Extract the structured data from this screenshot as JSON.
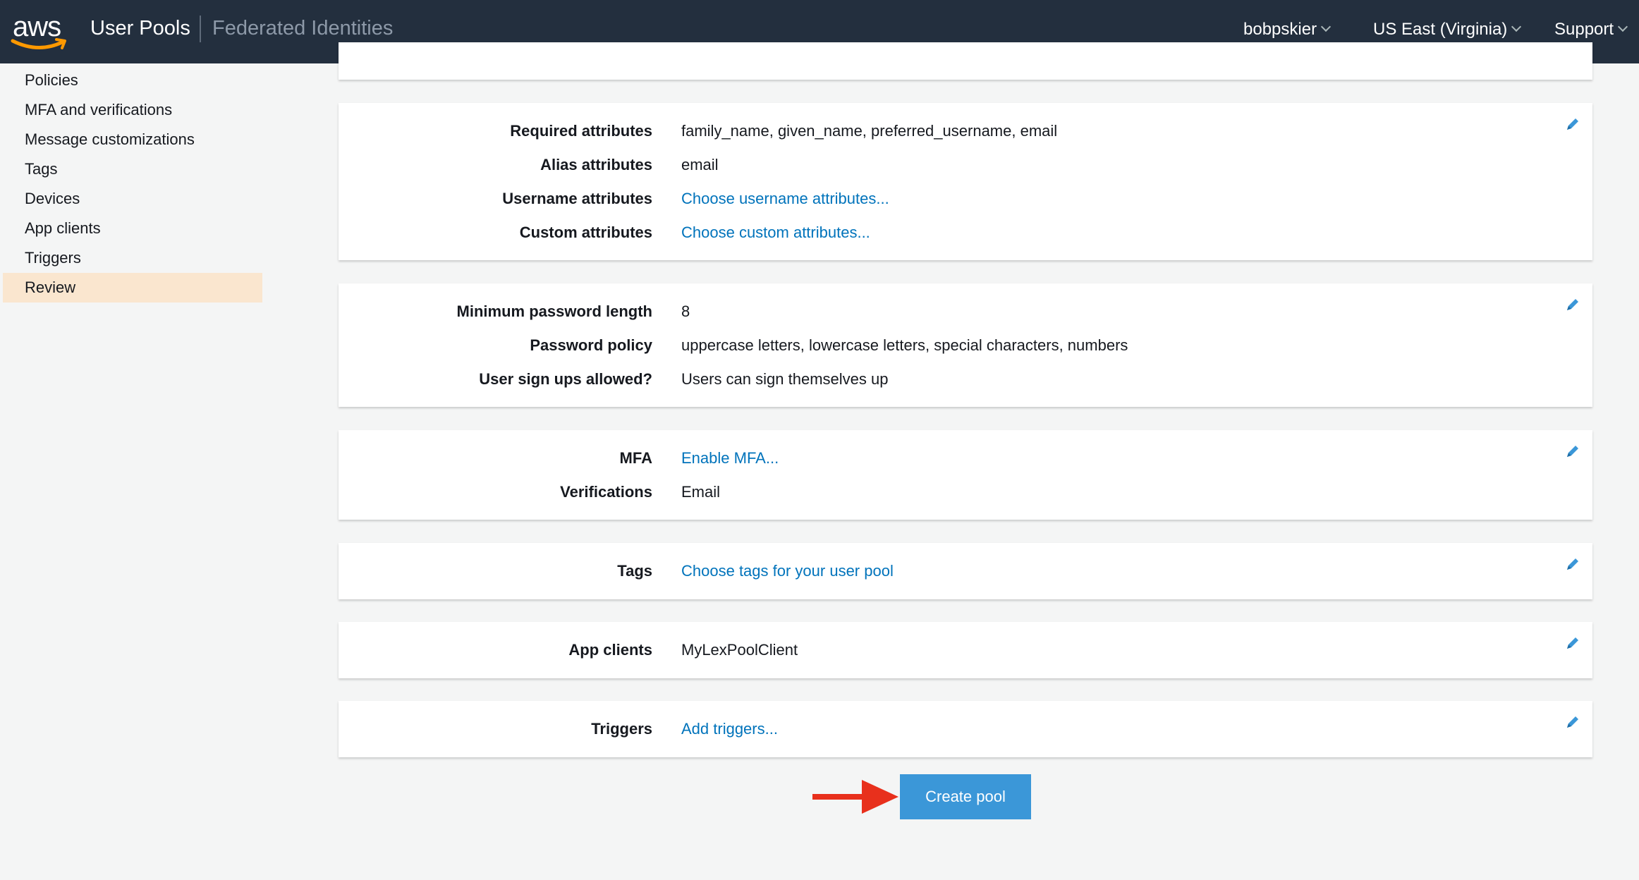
{
  "header": {
    "logo_text": "aws",
    "nav_main": "User Pools",
    "nav_sub": "Federated Identities",
    "user": "bobpskier",
    "region": "US East (Virginia)",
    "support": "Support"
  },
  "sidebar": {
    "items": [
      {
        "label": "Policies"
      },
      {
        "label": "MFA and verifications"
      },
      {
        "label": "Message customizations"
      },
      {
        "label": "Tags"
      },
      {
        "label": "Devices"
      },
      {
        "label": "App clients"
      },
      {
        "label": "Triggers"
      },
      {
        "label": "Review"
      }
    ],
    "active": "Review"
  },
  "sections": {
    "attributes": {
      "required_label": "Required attributes",
      "required_value": "family_name, given_name, preferred_username, email",
      "alias_label": "Alias attributes",
      "alias_value": "email",
      "username_label": "Username attributes",
      "username_value": "Choose username attributes...",
      "custom_label": "Custom attributes",
      "custom_value": "Choose custom attributes..."
    },
    "policies": {
      "minlen_label": "Minimum password length",
      "minlen_value": "8",
      "policy_label": "Password policy",
      "policy_value": "uppercase letters, lowercase letters, special characters, numbers",
      "signup_label": "User sign ups allowed?",
      "signup_value": "Users can sign themselves up"
    },
    "mfa": {
      "mfa_label": "MFA",
      "mfa_value": "Enable MFA...",
      "verif_label": "Verifications",
      "verif_value": "Email"
    },
    "tags": {
      "label": "Tags",
      "value": "Choose tags for your user pool"
    },
    "app_clients": {
      "label": "App clients",
      "value": "MyLexPoolClient"
    },
    "triggers": {
      "label": "Triggers",
      "value": "Add triggers..."
    }
  },
  "actions": {
    "create_label": "Create pool"
  },
  "colors": {
    "header_bg": "#232f3e",
    "link": "#0073bb",
    "button": "#3b97d8",
    "active_nav": "#fae6cf",
    "arrow": "#e8301c"
  },
  "icons": {
    "edit": "pencil-icon",
    "annotation": "red-arrow-icon"
  }
}
